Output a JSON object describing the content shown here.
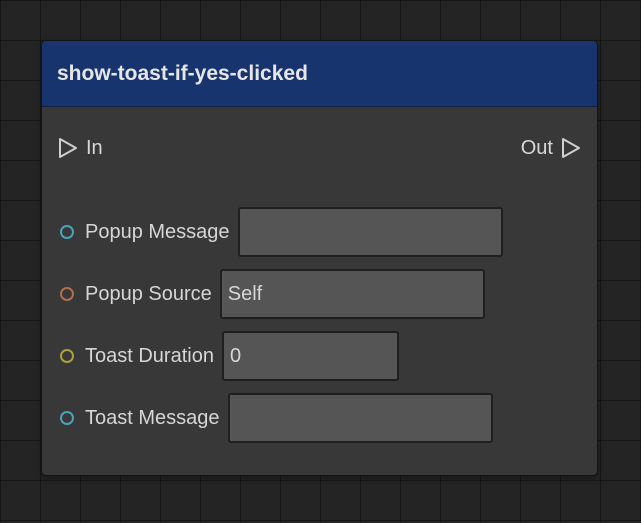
{
  "node": {
    "title": "show-toast-if-yes-clicked",
    "header_color": "#17346f",
    "exec_in_label": "In",
    "exec_out_label": "Out",
    "params": [
      {
        "label": "Popup Message",
        "value": "",
        "pin_color": "#4aa3b8",
        "pin_icon": "circle-pin-icon"
      },
      {
        "label": "Popup Source",
        "value": "Self",
        "pin_color": "#b0704a",
        "pin_icon": "circle-pin-icon"
      },
      {
        "label": "Toast Duration",
        "value": "0",
        "pin_color": "#a8a23a",
        "pin_icon": "circle-pin-icon"
      },
      {
        "label": "Toast Message",
        "value": "",
        "pin_color": "#4aa3b8",
        "pin_icon": "circle-pin-icon"
      }
    ]
  }
}
